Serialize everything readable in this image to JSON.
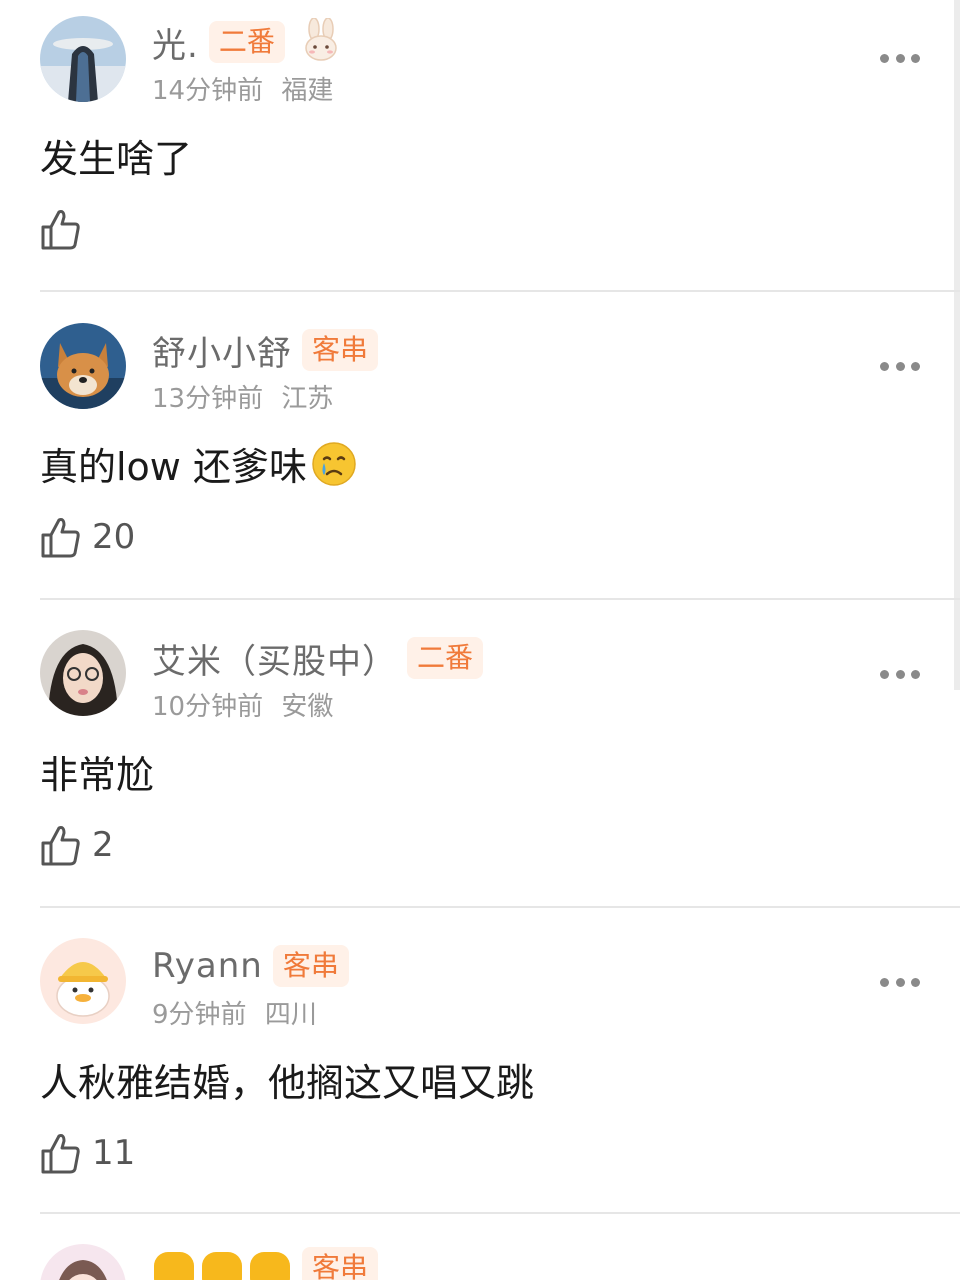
{
  "comments": [
    {
      "username": "光.",
      "badge": "二番",
      "time": "14分钟前",
      "location": "福建",
      "text": "发生啥了",
      "likes": ""
    },
    {
      "username": "舒小小舒",
      "badge": "客串",
      "time": "13分钟前",
      "location": "江苏",
      "text": "真的low 还爹味",
      "emoji_icon": "crying-face-icon",
      "likes": "20"
    },
    {
      "username": "艾米（买股中）",
      "badge": "二番",
      "time": "10分钟前",
      "location": "安徽",
      "text": "非常尬",
      "likes": "2"
    },
    {
      "username": "Ryann",
      "badge": "客串",
      "time": "9分钟前",
      "location": "四川",
      "text": "人秋雅结婚，他搁这又唱又跳",
      "likes": "11"
    },
    {
      "badge": "客串"
    }
  ],
  "icons": {
    "more": "more-icon",
    "like": "thumbs-up-icon",
    "badge_extra": "bunny-icon",
    "name_emoji": "hand-icon"
  },
  "colors": {
    "badge_bg": "#fff1e8",
    "badge_text": "#f07a3a",
    "username": "#6b6b6b",
    "meta": "#9a9a9a"
  }
}
